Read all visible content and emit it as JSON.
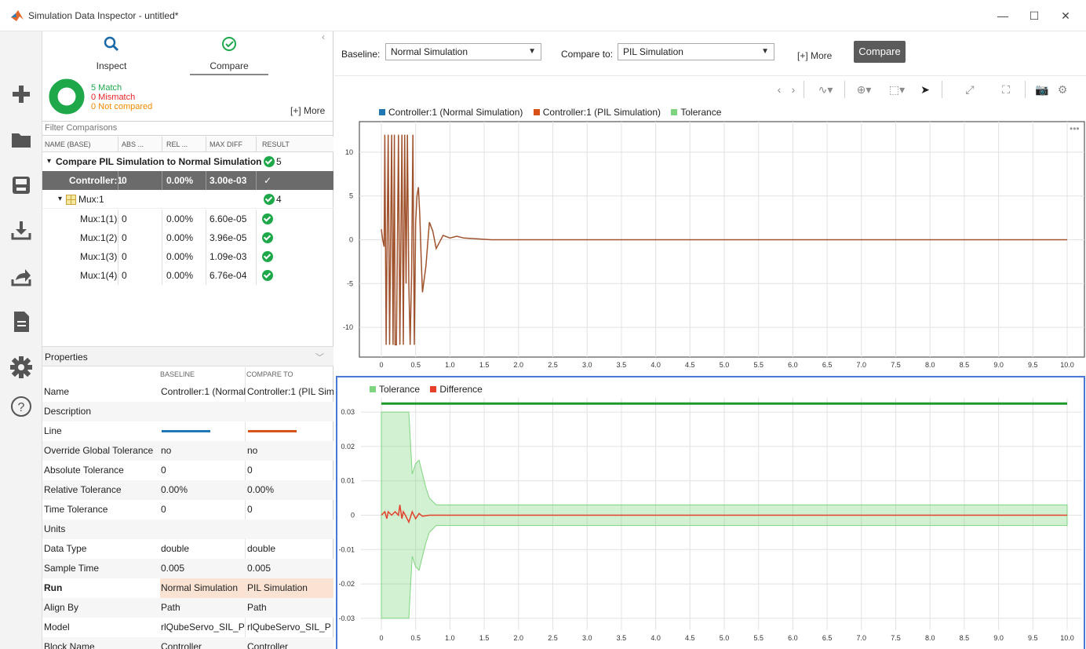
{
  "window": {
    "title": "Simulation Data Inspector - untitled*",
    "minimize": "—",
    "maximize": "☐",
    "close": "✕"
  },
  "rail": {
    "icons": [
      "add-icon",
      "folder-icon",
      "save-icon",
      "import-icon",
      "share-icon",
      "report-icon",
      "settings-icon",
      "help-icon"
    ]
  },
  "modes": {
    "inspect_label": "Inspect",
    "compare_label": "Compare",
    "active": "Compare"
  },
  "summary": {
    "match": "5 Match",
    "mismatch": "0 Mismatch",
    "not_compared": "0 Not compared",
    "more": "[+] More",
    "match_color": "#1ea84a",
    "mismatch_color": "#e5252a",
    "not_compared_color": "#f08a00"
  },
  "filter": {
    "placeholder": "Filter Comparisons"
  },
  "table": {
    "columns": [
      "NAME (BASE)",
      "ABS ...",
      "REL ...",
      "MAX DIFF",
      "RESULT"
    ],
    "group": {
      "name": "Compare PIL Simulation to Normal Simulation",
      "count": "5"
    },
    "selected": {
      "name": "Controller:1",
      "abs": "0",
      "rel": "0.00%",
      "maxdiff": "3.00e-03"
    },
    "mux": {
      "name": "Mux:1",
      "count": "4"
    },
    "rows": [
      {
        "name": "Mux:1(1)",
        "abs": "0",
        "rel": "0.00%",
        "maxdiff": "6.60e-05"
      },
      {
        "name": "Mux:1(2)",
        "abs": "0",
        "rel": "0.00%",
        "maxdiff": "3.96e-05"
      },
      {
        "name": "Mux:1(3)",
        "abs": "0",
        "rel": "0.00%",
        "maxdiff": "1.09e-03"
      },
      {
        "name": "Mux:1(4)",
        "abs": "0",
        "rel": "0.00%",
        "maxdiff": "6.76e-04"
      }
    ]
  },
  "properties": {
    "title": "Properties",
    "col_baseline": "BASELINE",
    "col_compare": "COMPARE TO",
    "rows": [
      {
        "key": "Name",
        "baseline": "Controller:1 (Normal",
        "compare": "Controller:1 (PIL Sim"
      },
      {
        "key": "Description",
        "baseline": "",
        "compare": ""
      },
      {
        "key": "Line",
        "baseline": "",
        "compare": ""
      },
      {
        "key": "Override Global Tolerance",
        "baseline": "no",
        "compare": "no"
      },
      {
        "key": "Absolute Tolerance",
        "baseline": "0",
        "compare": "0"
      },
      {
        "key": "Relative Tolerance",
        "baseline": "0.00%",
        "compare": "0.00%"
      },
      {
        "key": "Time Tolerance",
        "baseline": "0",
        "compare": "0"
      },
      {
        "key": "Units",
        "baseline": "",
        "compare": ""
      },
      {
        "key": "Data Type",
        "baseline": "double",
        "compare": "double"
      },
      {
        "key": "Sample Time",
        "baseline": "0.005",
        "compare": "0.005"
      },
      {
        "key": "Run",
        "baseline": "Normal Simulation",
        "compare": "PIL Simulation"
      },
      {
        "key": "Align By",
        "baseline": "Path",
        "compare": "Path"
      },
      {
        "key": "Model",
        "baseline": "rlQubeServo_SIL_P",
        "compare": "rlQubeServo_SIL_P"
      },
      {
        "key": "Block Name",
        "baseline": "Controller",
        "compare": "Controller"
      }
    ],
    "line_colors": {
      "baseline": "#1f77b4",
      "compare": "#d95319"
    }
  },
  "toolbar": {
    "baseline_label": "Baseline:",
    "baseline_value": "Normal Simulation",
    "compare_to_label": "Compare to:",
    "compare_to_value": "PIL Simulation",
    "more": "[+] More",
    "compare_button": "Compare"
  },
  "chart_data": [
    {
      "type": "line",
      "legend": [
        {
          "name": "Controller:1 (Normal Simulation)",
          "color": "#1f77b4"
        },
        {
          "name": "Controller:1 (PIL Simulation)",
          "color": "#d95319"
        },
        {
          "name": "Tolerance",
          "color": "#7fd47f"
        }
      ],
      "xlim": [
        0,
        10
      ],
      "ylim": [
        -12.5,
        12.5
      ],
      "xticks": [
        "0",
        "0.5",
        "1.0",
        "1.5",
        "2.0",
        "2.5",
        "3.0",
        "3.5",
        "4.0",
        "4.5",
        "5.0",
        "5.5",
        "6.0",
        "6.5",
        "7.0",
        "7.5",
        "8.0",
        "8.5",
        "9.0",
        "9.5",
        "10.0"
      ],
      "yticks": [
        "10",
        "5",
        "0",
        "-5",
        "-10"
      ],
      "grid": true,
      "series": [
        {
          "name": "Controller:1 (PIL Simulation)",
          "x": [
            0,
            0.02,
            0.04,
            0.05,
            0.07,
            0.1,
            0.12,
            0.15,
            0.17,
            0.19,
            0.2,
            0.22,
            0.25,
            0.27,
            0.3,
            0.32,
            0.34,
            0.36,
            0.38,
            0.4,
            0.42,
            0.44,
            0.46,
            0.48,
            0.5,
            0.52,
            0.54,
            0.56,
            0.58,
            0.6,
            0.65,
            0.7,
            0.75,
            0.8,
            0.9,
            1.0,
            1.1,
            1.2,
            1.4,
            1.6,
            1.8,
            2.0,
            3.0,
            10.0
          ],
          "y": [
            1.2,
            0,
            -0.8,
            12,
            -12,
            12,
            -12,
            12,
            -12,
            12,
            -12,
            -12,
            12,
            -12,
            12,
            -12,
            12,
            -5,
            12,
            -5,
            -12,
            -4,
            12,
            -12,
            2,
            5,
            6,
            3,
            -2,
            -6,
            -3,
            2,
            1,
            -1,
            0.5,
            0.2,
            0.4,
            0.2,
            0.1,
            0,
            0,
            0,
            0,
            0
          ]
        }
      ]
    },
    {
      "type": "line",
      "legend": [
        {
          "name": "Tolerance",
          "color": "#7fd47f"
        },
        {
          "name": "Difference",
          "color": "#e5402a"
        }
      ],
      "xlim": [
        0,
        10
      ],
      "ylim": [
        -0.033,
        0.033
      ],
      "xticks": [
        "0",
        "0.5",
        "1.0",
        "1.5",
        "2.0",
        "2.5",
        "3.0",
        "3.5",
        "4.0",
        "4.5",
        "5.0",
        "5.5",
        "6.0",
        "6.5",
        "7.0",
        "7.5",
        "8.0",
        "8.5",
        "9.0",
        "9.5",
        "10.0"
      ],
      "yticks": [
        "0.03",
        "0.02",
        "0.01",
        "0",
        "-0.01",
        "-0.02",
        "-0.03"
      ],
      "grid": true,
      "tolerance_band": {
        "x": [
          0,
          0.05,
          0.1,
          0.15,
          0.2,
          0.25,
          0.3,
          0.35,
          0.4,
          0.45,
          0.5,
          0.55,
          0.6,
          0.65,
          0.7,
          0.75,
          0.8,
          0.9,
          1.0,
          10.0
        ],
        "upper": [
          0.03,
          0.03,
          0.03,
          0.03,
          0.03,
          0.03,
          0.03,
          0.03,
          0.03,
          0.012,
          0.015,
          0.016,
          0.012,
          0.008,
          0.005,
          0.004,
          0.003,
          0.003,
          0.003,
          0.003
        ],
        "lower": [
          -0.03,
          -0.03,
          -0.03,
          -0.03,
          -0.03,
          -0.03,
          -0.03,
          -0.03,
          -0.03,
          -0.012,
          -0.015,
          -0.016,
          -0.012,
          -0.008,
          -0.005,
          -0.004,
          -0.003,
          -0.003,
          -0.003,
          -0.003
        ]
      },
      "series": [
        {
          "name": "Difference",
          "x": [
            0,
            0.05,
            0.08,
            0.1,
            0.15,
            0.2,
            0.25,
            0.27,
            0.3,
            0.32,
            0.35,
            0.4,
            0.45,
            0.5,
            0.55,
            0.6,
            0.7,
            0.8,
            1.0,
            10.0
          ],
          "y": [
            0,
            0.001,
            -0.001,
            0.001,
            0,
            0.001,
            0,
            0.003,
            -0.001,
            0.001,
            0.0,
            -0.002,
            0.001,
            -0.001,
            0.0005,
            -0.0003,
            0,
            0,
            0,
            0
          ]
        },
        {
          "name": "Upper line",
          "x": [
            0,
            10
          ],
          "y": [
            0.0325,
            0.0325
          ]
        }
      ]
    }
  ]
}
